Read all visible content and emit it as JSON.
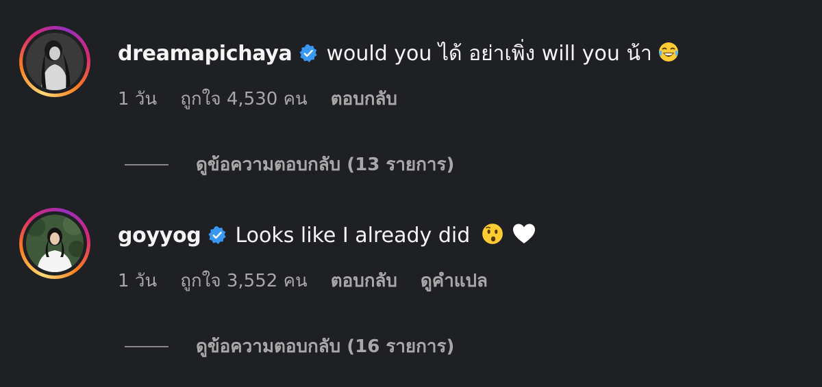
{
  "comments": [
    {
      "username": "dreamapichaya",
      "verified": true,
      "text": "would you ได้ อย่าเพิ่ง will you น้า",
      "emoji_icon": "tears-of-joy-emoji",
      "time": "1 วัน",
      "likes": "ถูกใจ 4,530 คน",
      "reply_label": "ตอบกลับ",
      "view_replies": "ดูข้อความตอบกลับ (13 รายการ)"
    },
    {
      "username": "goyyog",
      "verified": true,
      "text": "Looks like I already did",
      "emoji_icons": [
        "hushed-face-emoji",
        "white-heart-emoji"
      ],
      "time": "1 วัน",
      "likes": "ถูกใจ 3,552 คน",
      "reply_label": "ตอบกลับ",
      "translate_label": "ดูคำแปล",
      "view_replies": "ดูข้อความตอบกลับ (16 รายการ)"
    }
  ],
  "colors": {
    "background": "#1f2024",
    "verified_badge": "#3897f0",
    "secondary_text": "#a8a8a8"
  }
}
